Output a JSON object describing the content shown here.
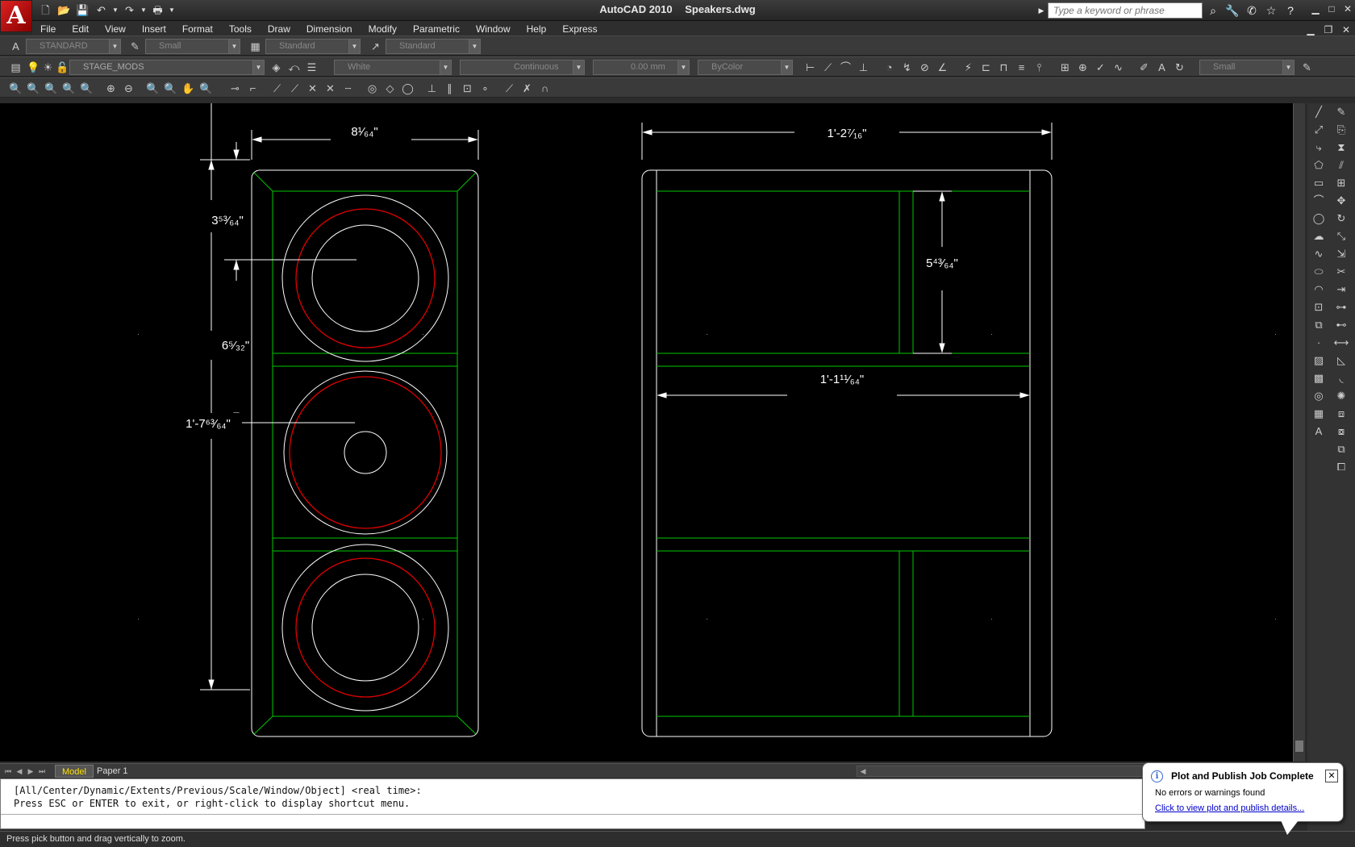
{
  "title": {
    "app": "AutoCAD 2010",
    "file": "Speakers.dwg"
  },
  "app_logo": "A",
  "search": {
    "placeholder": "Type a keyword or phrase"
  },
  "menu": [
    "File",
    "Edit",
    "View",
    "Insert",
    "Format",
    "Tools",
    "Draw",
    "Dimension",
    "Modify",
    "Parametric",
    "Window",
    "Help",
    "Express"
  ],
  "styles_toolbar": {
    "text_style": "STANDARD",
    "dim_style": "Small",
    "table_style": "Standard",
    "mleader_style": "Standard"
  },
  "layers_toolbar": {
    "layer": "STAGE_MODS",
    "color": "White",
    "linetype": "Continuous",
    "lineweight": "0.00 mm",
    "plotstyle": "ByColor",
    "dim_style_right": "Small"
  },
  "dimensions": {
    "front_width": "8¹⁄₆₄\"",
    "front_top_offset": "3⁵³⁄₆₄\"",
    "front_spacing": "6⁵⁄₃₂\"",
    "front_height": "1'-7⁶³⁄₆₄\"",
    "side_width": "1'-2⁷⁄₁₆\"",
    "side_inner_height": "5⁴³⁄₆₄\"",
    "side_inner_width": "1'-1¹¹⁄₆₄\""
  },
  "layout_tabs": {
    "model": "Model",
    "paper1": "Paper 1"
  },
  "command_line": {
    "line1": "[All/Center/Dynamic/Extents/Previous/Scale/Window/Object] <real time>:",
    "line2": "Press ESC or ENTER to exit, or right-click to display shortcut menu."
  },
  "status_text": "Press pick button and drag vertically to zoom.",
  "notification": {
    "title": "Plot and Publish Job Complete",
    "message": "No errors or warnings found",
    "link": "Click to view plot and publish details..."
  },
  "colors": {
    "drawing_bg": "#000000",
    "lines_white": "#ffffff",
    "lines_green": "#00c800",
    "lines_red": "#e00000",
    "model_tab": "#ffe000"
  }
}
